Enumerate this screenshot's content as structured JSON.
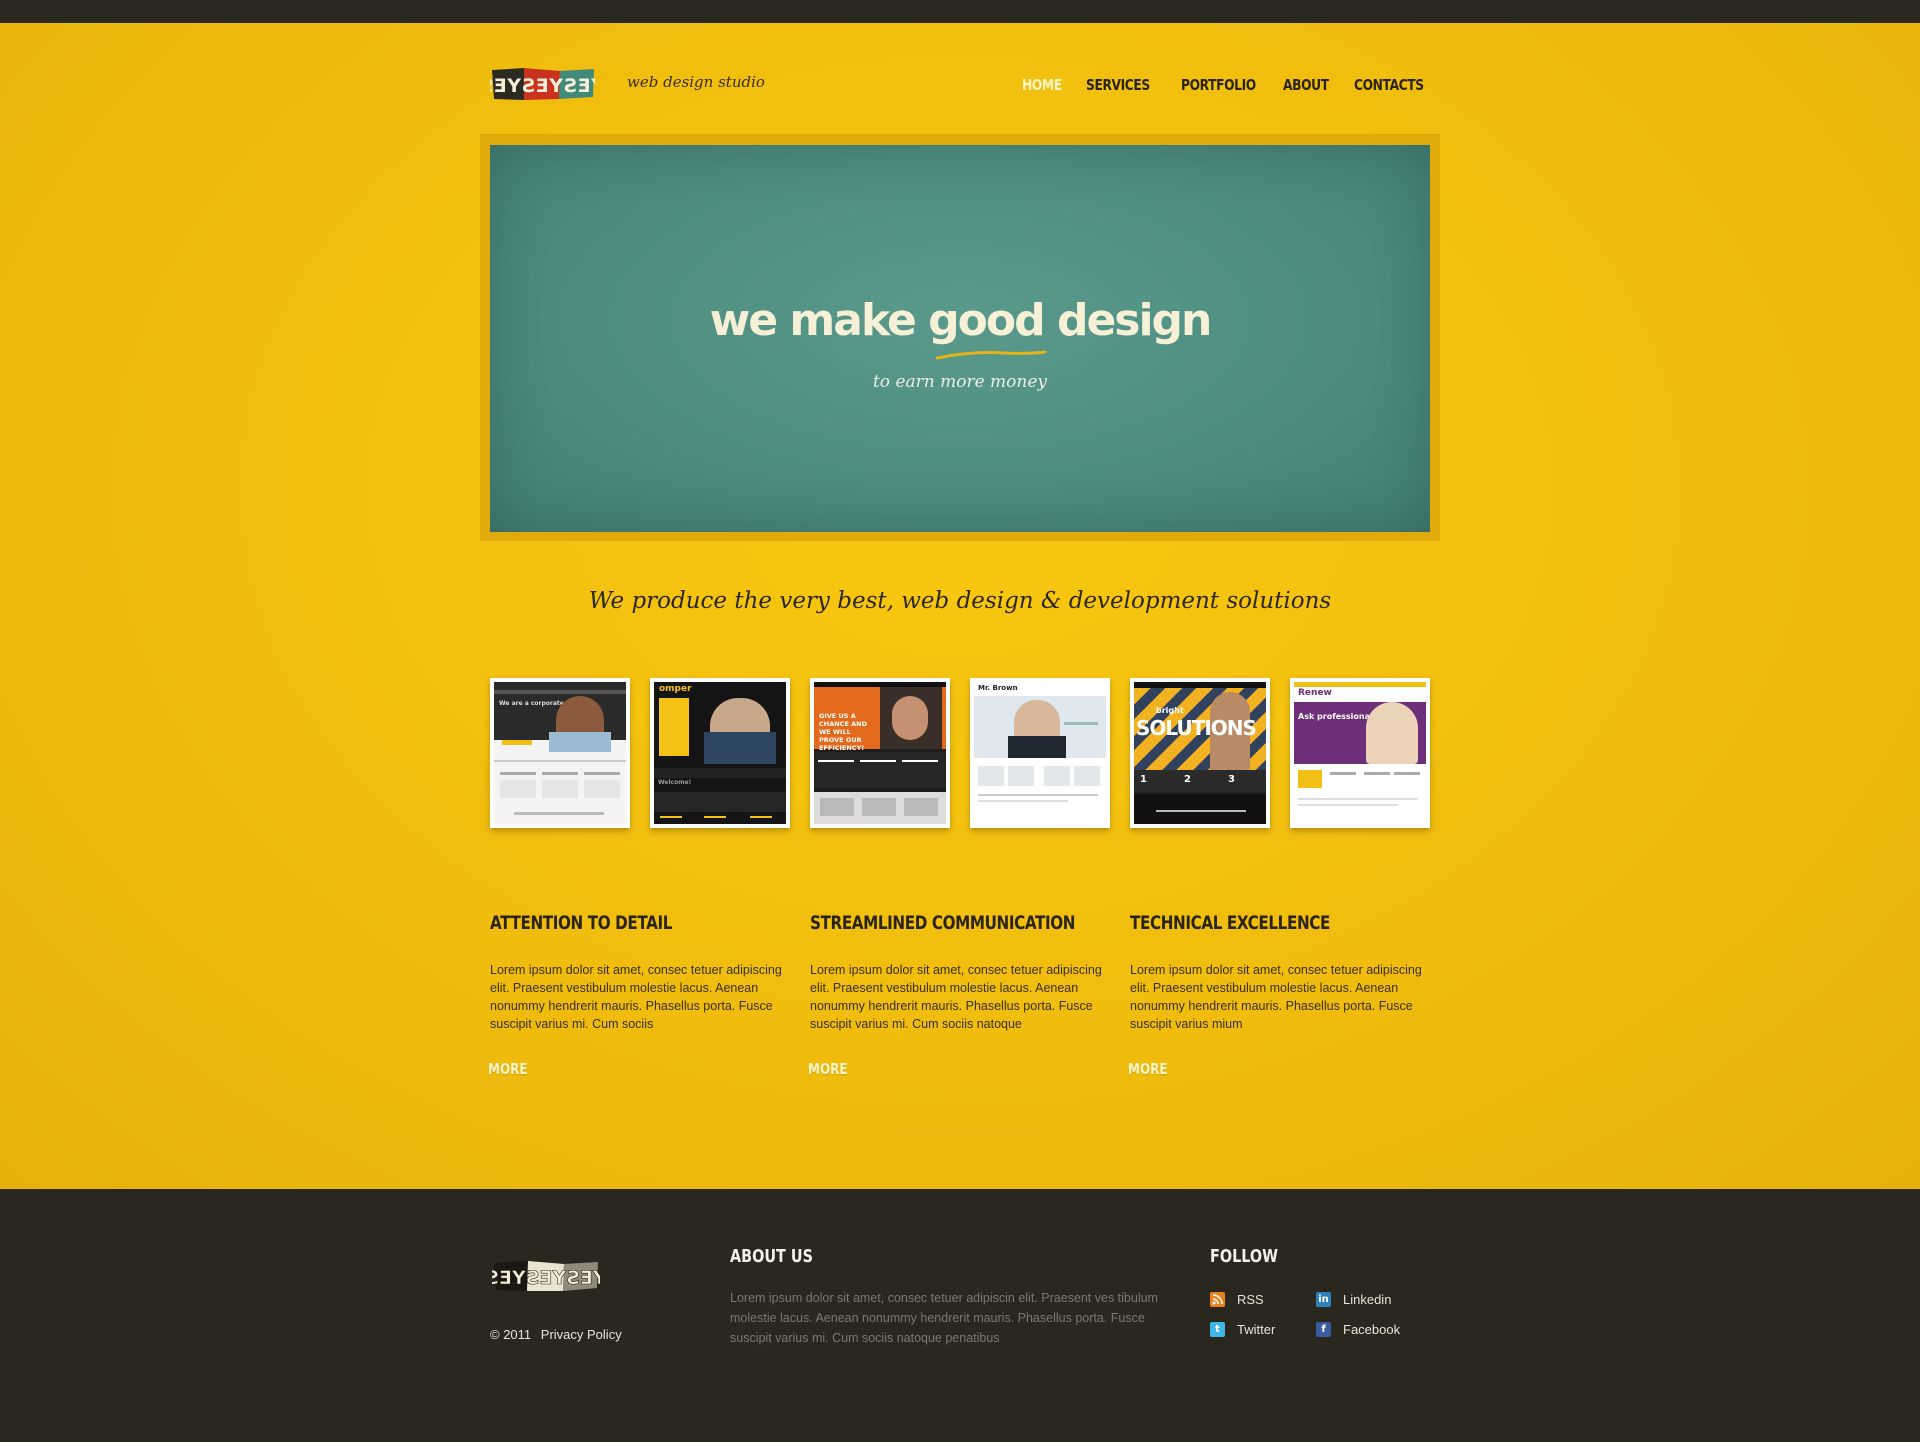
{
  "brand": {
    "logo_text": "YESYESYES",
    "tagline": "web design studio"
  },
  "nav": {
    "items": [
      {
        "label": "HOME",
        "active": true
      },
      {
        "label": "SERVICES",
        "active": false
      },
      {
        "label": "PORTFOLIO",
        "active": false
      },
      {
        "label": "ABOUT",
        "active": false
      },
      {
        "label": "CONTACTS",
        "active": false
      }
    ]
  },
  "hero": {
    "title": "we make good design",
    "subtitle": "to earn more money"
  },
  "slogan": "We produce the very best, web design & development solutions",
  "portfolio": {
    "thumbnails": [
      {
        "title": "",
        "heading": "We are a corporate",
        "accent": "#f2c014",
        "bg": "#2a2a2a"
      },
      {
        "title": "omper",
        "heading": "Welcome!",
        "accent": "#f5c316",
        "bg": "#141414"
      },
      {
        "title": "",
        "heading": "GIVE US A CHANCE AND WE WILL PROVE OUR EFFICIENCY!",
        "accent": "#e36a1c",
        "bg": "#1d1d1d"
      },
      {
        "title": "Mr. Brown",
        "heading": "",
        "accent": "#7a9cc0",
        "bg": "#ffffff"
      },
      {
        "title": "bright",
        "heading": "SOLUTIONS",
        "accent": "#f2b120",
        "bg": "#202020"
      },
      {
        "title": "Renew",
        "heading": "Ask professionals",
        "accent": "#6d2f78",
        "bg": "#ffffff"
      }
    ]
  },
  "features": [
    {
      "title": "ATTENTION TO DETAIL",
      "text": "Lorem ipsum dolor sit amet, consec tetuer adipiscing elit. Praesent vestibulum molestie lacus. Aenean nonummy hendrerit mauris. Phasellus porta. Fusce suscipit varius mi. Cum sociis",
      "more": "MORE"
    },
    {
      "title": "STREAMLINED COMMUNICATION",
      "text": "Lorem ipsum dolor sit amet, consec tetuer adipiscing elit. Praesent vestibulum molestie lacus. Aenean nonummy hendrerit mauris. Phasellus porta. Fusce suscipit varius mi. Cum sociis natoque",
      "more": "MORE"
    },
    {
      "title": "TECHNICAL EXCELLENCE",
      "text": "Lorem ipsum dolor sit amet, consec tetuer adipiscing elit. Praesent vestibulum molestie lacus. Aenean nonummy hendrerit mauris. Phasellus porta. Fusce suscipit varius mium",
      "more": "MORE"
    }
  ],
  "footer": {
    "copyright": "© 2011",
    "privacy": "Privacy Policy",
    "about_title": "ABOUT US",
    "about_text": "Lorem ipsum dolor sit amet, consec tetuer adipiscin elit. Praesent ves tibulum molestie lacus. Aenean nonummy hendrerit mauris. Phasellus porta. Fusce suscipit varius mi. Cum sociis natoque penatibus",
    "follow_title": "FOLLOW",
    "follow": [
      {
        "label": "RSS",
        "icon": "rss-icon",
        "color": "#e8821c"
      },
      {
        "label": "Linkedin",
        "icon": "linkedin-icon",
        "color": "#2f7fb8"
      },
      {
        "label": "Twitter",
        "icon": "twitter-icon",
        "color": "#3fb6e8"
      },
      {
        "label": "Facebook",
        "icon": "facebook-icon",
        "color": "#3b5b9e"
      }
    ]
  },
  "colors": {
    "page_bg": "#f2bf12",
    "hero_bg": "#4e8d80",
    "footer_bg": "#2a271e",
    "nav_active": "#fff4c2"
  }
}
